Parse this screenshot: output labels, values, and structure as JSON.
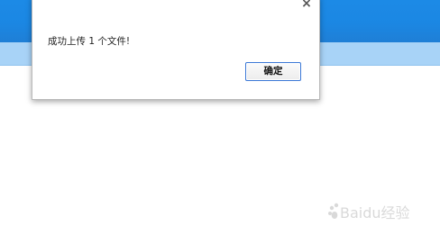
{
  "dialog": {
    "close_symbol": "×",
    "message": "成功上传 1 个文件!",
    "ok_label": "确定"
  },
  "watermark": {
    "brand": "Baidu经验"
  },
  "colors": {
    "header_blue": "#1c8ae6",
    "subheader_light_blue": "#a8d3f7",
    "ok_border": "#3b78d6"
  },
  "icons": {
    "close": "close-icon",
    "watermark": "baidu-paw-icon"
  }
}
